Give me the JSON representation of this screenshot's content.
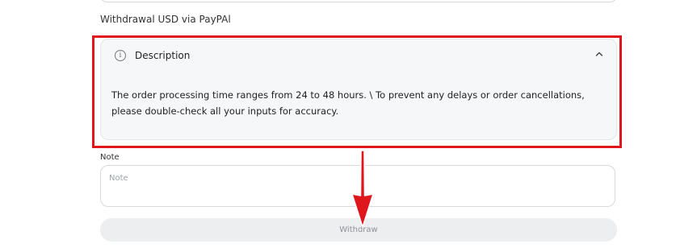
{
  "method_label": "Withdrawal USD via PayPAl",
  "description": {
    "title": "Description",
    "icon": "info-icon",
    "toggle_icon": "chevron-up-icon",
    "text": "The order processing time ranges from 24 to 48 hours. \\ To prevent any delays or order cancellations, please double-check all your inputs for accuracy."
  },
  "note": {
    "label": "Note",
    "placeholder": "Note",
    "value": ""
  },
  "withdraw_button": {
    "label": "Withdraw"
  },
  "colors": {
    "highlight": "#e0161d",
    "panel_bg": "#f6f7f9",
    "button_bg": "#eceef0",
    "button_text": "#8f9296"
  }
}
